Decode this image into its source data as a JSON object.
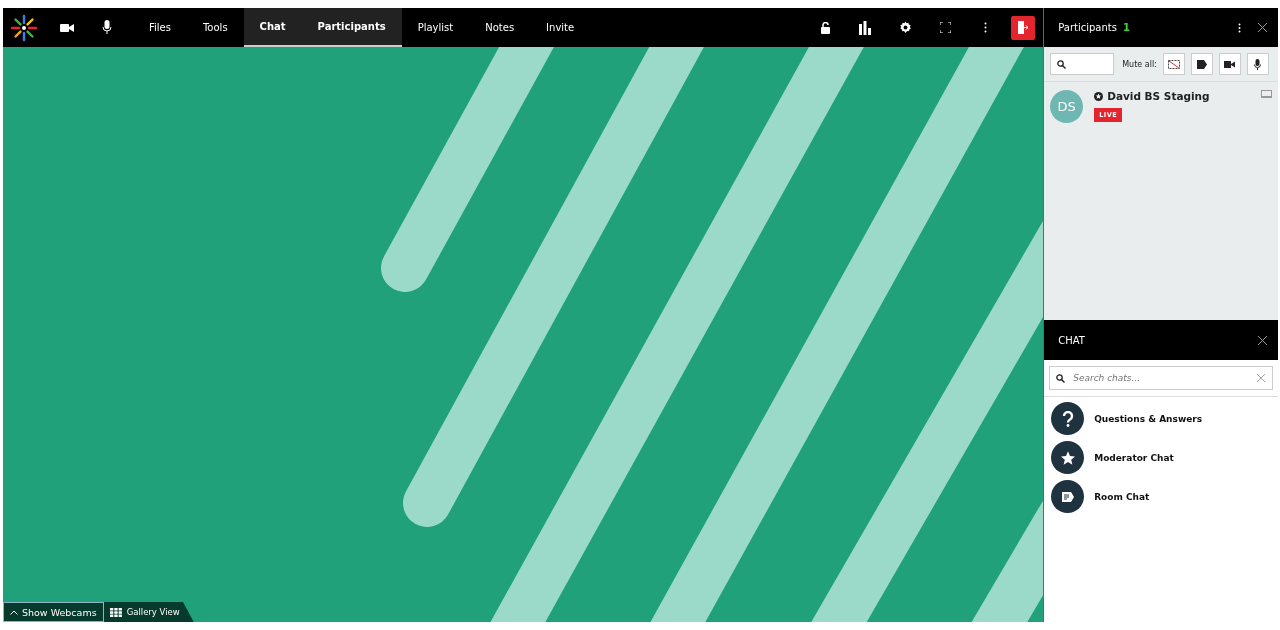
{
  "toolbar": {
    "tabs": [
      {
        "label": "Files",
        "selected": false
      },
      {
        "label": "Tools",
        "selected": false
      },
      {
        "label": "Chat",
        "selected": true
      },
      {
        "label": "Participants",
        "selected": true
      },
      {
        "label": "Playlist",
        "selected": false
      },
      {
        "label": "Notes",
        "selected": false
      },
      {
        "label": "Invite",
        "selected": false
      }
    ]
  },
  "stage": {
    "buttons": [
      {
        "label": "Show Webcams",
        "kind": "webcams"
      },
      {
        "label": "Gallery View",
        "kind": "gallery"
      }
    ]
  },
  "participants": {
    "title": "Participants",
    "count": "1",
    "mute_all_label": "Mute all:",
    "people": [
      {
        "initials": "DS",
        "name": "David BS Staging",
        "badge": "LIVE"
      }
    ]
  },
  "chat": {
    "title": "CHAT",
    "search_placeholder": "Search chats...",
    "rooms": [
      {
        "name": "Questions & Answers",
        "kind": "qa"
      },
      {
        "name": "Moderator Chat",
        "kind": "moderator"
      },
      {
        "name": "Room Chat",
        "kind": "room"
      }
    ]
  }
}
